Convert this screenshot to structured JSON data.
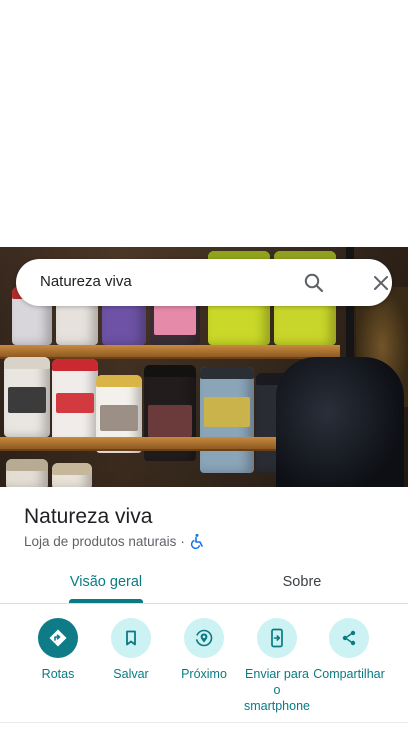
{
  "search": {
    "query": "Natureza viva"
  },
  "place": {
    "name": "Natureza viva",
    "category": "Loja de produtos naturais",
    "separator": "·"
  },
  "tabs": [
    {
      "label": "Visão geral",
      "active": true
    },
    {
      "label": "Sobre",
      "active": false
    }
  ],
  "actions": [
    {
      "label": "Rotas",
      "icon": "directions-icon"
    },
    {
      "label": "Salvar",
      "icon": "bookmark-icon"
    },
    {
      "label": "Próximo",
      "icon": "nearby-icon"
    },
    {
      "label": "Enviar para o smartphone",
      "icon": "send-to-phone-icon"
    },
    {
      "label": "Compartilhar",
      "icon": "share-icon"
    }
  ],
  "colors": {
    "accent": "#0a7b83",
    "accent_light": "#cdf2f3",
    "primary_button": "#0e7c86"
  }
}
